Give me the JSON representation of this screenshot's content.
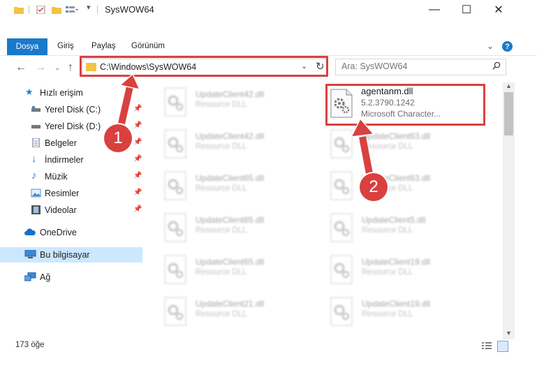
{
  "window": {
    "title": "SysWOW64",
    "minimize": "—",
    "maximize": "☐",
    "close": "✕"
  },
  "ribbon": {
    "tabs": [
      "Dosya",
      "Giriş",
      "Paylaş",
      "Görünüm"
    ],
    "help": "?"
  },
  "navigation": {
    "address": "C:\\Windows\\SysWOW64",
    "search_placeholder": "Ara: SysWOW64"
  },
  "sidebar": {
    "items": [
      {
        "label": "Hızlı erişim",
        "icon": "star-icon",
        "pinned": false
      },
      {
        "label": "Yerel Disk (C:)",
        "icon": "drive-icon",
        "pinned": true
      },
      {
        "label": "Yerel Disk (D:)",
        "icon": "drive-icon",
        "pinned": true
      },
      {
        "label": "Belgeler",
        "icon": "documents-icon",
        "pinned": true
      },
      {
        "label": "İndirmeler",
        "icon": "download-icon",
        "pinned": true
      },
      {
        "label": "Müzik",
        "icon": "music-icon",
        "pinned": true
      },
      {
        "label": "Resimler",
        "icon": "pictures-icon",
        "pinned": true
      },
      {
        "label": "Videolar",
        "icon": "videos-icon",
        "pinned": true
      },
      {
        "label": "OneDrive",
        "icon": "cloud-icon",
        "pinned": false
      },
      {
        "label": "Bu bilgisayar",
        "icon": "computer-icon",
        "pinned": false,
        "selected": true
      },
      {
        "label": "Ağ",
        "icon": "network-icon",
        "pinned": false
      }
    ]
  },
  "featured_file": {
    "name": "agentanm.dll",
    "version": "5.2.3790.1242",
    "description": "Microsoft Character..."
  },
  "files": [
    {
      "name": "UpdateClient42.dll",
      "desc": "Resource DLL"
    },
    {
      "name": "UpdateClient42.dll",
      "desc": "Resource DLL"
    },
    {
      "name": "UpdateClient63.dll",
      "desc": "Resource DLL"
    },
    {
      "name": "UpdateClient65.dll",
      "desc": "Resource DLL"
    },
    {
      "name": "UpdateClient63.dll",
      "desc": "Resource DLL"
    },
    {
      "name": "UpdateClient65.dll",
      "desc": "Resource DLL"
    },
    {
      "name": "UpdateClient5.dll",
      "desc": "Resource DLL"
    },
    {
      "name": "UpdateClient65.dll",
      "desc": "Resource DLL"
    },
    {
      "name": "UpdateClient19.dll",
      "desc": "Resource DLL"
    },
    {
      "name": "UpdateClient21.dll",
      "desc": "Resource DLL"
    },
    {
      "name": "UpdateClient19.dll",
      "desc": "Resource DLL"
    }
  ],
  "status": {
    "item_count": "173 öğe"
  },
  "annotations": {
    "step1": "1",
    "step2": "2",
    "color": "#d94040"
  },
  "colors": {
    "accent": "#1979ca",
    "selection": "#cce8ff"
  }
}
